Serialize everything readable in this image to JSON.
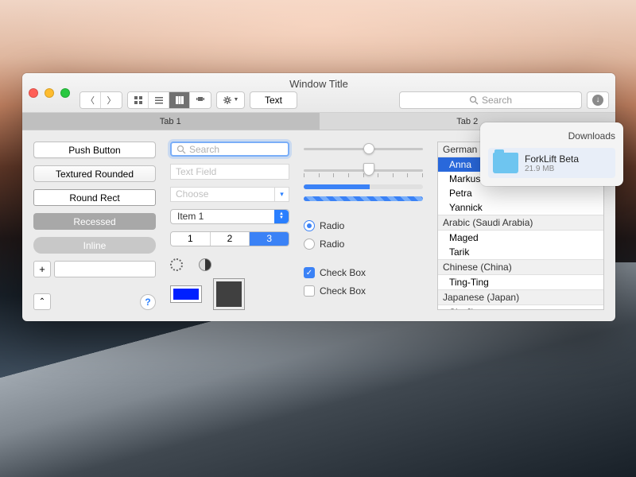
{
  "window": {
    "title": "Window Title"
  },
  "toolbar": {
    "text_button": "Text",
    "search_placeholder": "Search"
  },
  "tabs": [
    "Tab 1",
    "Tab 2"
  ],
  "buttons": {
    "push": "Push Button",
    "textured": "Textured Rounded",
    "roundrect": "Round Rect",
    "recessed": "Recessed",
    "inline": "Inline",
    "plus": "+",
    "help": "?"
  },
  "fields": {
    "search_placeholder": "Search",
    "textfield_placeholder": "Text Field",
    "combo_placeholder": "Choose",
    "popup_value": "Item 1"
  },
  "segments": [
    "1",
    "2",
    "3"
  ],
  "segment_selected": 2,
  "colors": {
    "well1": "#0020ff",
    "well2": "#404040"
  },
  "sliders": {
    "s1": 50,
    "s2": 50
  },
  "progress": {
    "determinate": 55
  },
  "radios": [
    {
      "label": "Radio",
      "checked": true
    },
    {
      "label": "Radio",
      "checked": false
    }
  ],
  "checkboxes": [
    {
      "label": "Check Box",
      "checked": true
    },
    {
      "label": "Check Box",
      "checked": false
    }
  ],
  "list": [
    {
      "header": "German (Germany)"
    },
    {
      "item": "Anna",
      "selected": true
    },
    {
      "item": "Markus"
    },
    {
      "item": "Petra"
    },
    {
      "item": "Yannick"
    },
    {
      "header": "Arabic (Saudi Arabia)"
    },
    {
      "item": "Maged"
    },
    {
      "item": "Tarik"
    },
    {
      "header": "Chinese (China)"
    },
    {
      "item": "Ting-Ting"
    },
    {
      "header": "Japanese (Japan)"
    },
    {
      "item": "Sin-Ji"
    }
  ],
  "popover": {
    "title": "Downloads",
    "item_name": "ForkLift Beta",
    "item_size": "21.9 MB"
  }
}
